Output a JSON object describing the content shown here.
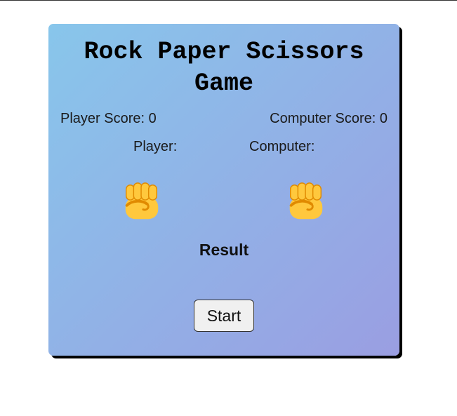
{
  "game": {
    "title": "Rock Paper Scissors Game",
    "player_score_label": "Player Score: 0",
    "computer_score_label": "Computer Score: 0",
    "player_label": "Player:",
    "computer_label": "Computer:",
    "player_choice_icon": "raised-fist-icon",
    "computer_choice_icon": "raised-fist-icon",
    "result_text": "Result",
    "start_label": "Start"
  },
  "colors": {
    "gradient_start": "#88c6eb",
    "gradient_end": "#9a9ee2",
    "card_shadow": "#000000",
    "fist_fill": "#ffc83d",
    "fist_stroke": "#e08a00"
  }
}
